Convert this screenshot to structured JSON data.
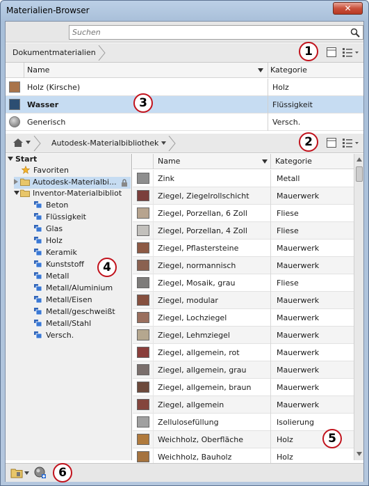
{
  "window": {
    "title": "Materialien-Browser",
    "close_label": "✕"
  },
  "search": {
    "placeholder": "Suchen"
  },
  "document": {
    "breadcrumb": "Dokumentmaterialien",
    "columns": {
      "name": "Name",
      "category": "Kategorie"
    },
    "rows": [
      {
        "name": "Holz (Kirsche)",
        "category": "Holz",
        "color": "#a9744a"
      },
      {
        "name": "Wasser",
        "category": "Flüssigkeit",
        "color": "#2c4e72",
        "selected": true
      },
      {
        "name": "Generisch",
        "category": "Versch.",
        "color": "#8a8a8a"
      }
    ]
  },
  "library": {
    "breadcrumb": "Autodesk-Materialbibliothek",
    "tree": {
      "root": "Start",
      "favorites": "Favoriten",
      "autodesk_lib": "Autodesk-Materialbi...",
      "inventor_lib": "Inventor-Materialbibliot",
      "categories": [
        "Beton",
        "Flüssigkeit",
        "Glas",
        "Holz",
        "Keramik",
        "Kunststoff",
        "Metall",
        "Metall/Aluminium",
        "Metall/Eisen",
        "Metall/geschweißt",
        "Metall/Stahl",
        "Versch."
      ]
    },
    "columns": {
      "name": "Name",
      "category": "Kategorie"
    },
    "rows": [
      {
        "name": "Zink",
        "category": "Metall",
        "color": "#8e8e8e"
      },
      {
        "name": "Ziegel, Ziegelrollschicht",
        "category": "Mauerwerk",
        "color": "#7b3f3c"
      },
      {
        "name": "Ziegel, Porzellan, 6 Zoll",
        "category": "Fliese",
        "color": "#b7a48f"
      },
      {
        "name": "Ziegel, Porzellan, 4 Zoll",
        "category": "Fliese",
        "color": "#c2c0bc"
      },
      {
        "name": "Ziegel, Pflastersteine",
        "category": "Mauerwerk",
        "color": "#8d5a45"
      },
      {
        "name": "Ziegel, normannisch",
        "category": "Mauerwerk",
        "color": "#8a6150"
      },
      {
        "name": "Ziegel, Mosaik, grau",
        "category": "Fliese",
        "color": "#7e7c7a"
      },
      {
        "name": "Ziegel, modular",
        "category": "Mauerwerk",
        "color": "#86503f"
      },
      {
        "name": "Ziegel, Lochziegel",
        "category": "Mauerwerk",
        "color": "#9a6f5e"
      },
      {
        "name": "Ziegel, Lehmziegel",
        "category": "Mauerwerk",
        "color": "#b5a78f"
      },
      {
        "name": "Ziegel, allgemein, rot",
        "category": "Mauerwerk",
        "color": "#8a3e3b"
      },
      {
        "name": "Ziegel, allgemein, grau",
        "category": "Mauerwerk",
        "color": "#7a6f6c"
      },
      {
        "name": "Ziegel, allgemein, braun",
        "category": "Mauerwerk",
        "color": "#6d4a3c"
      },
      {
        "name": "Ziegel, allgemein",
        "category": "Mauerwerk",
        "color": "#84453d"
      },
      {
        "name": "Zellulosefüllung",
        "category": "Isolierung",
        "color": "#a0a0a0"
      },
      {
        "name": "Weichholz, Oberfläche",
        "category": "Holz",
        "color": "#b07a3c"
      },
      {
        "name": "Weichholz, Bauholz",
        "category": "Holz",
        "color": "#a5733f"
      }
    ]
  },
  "badges": [
    "1",
    "2",
    "3",
    "4",
    "5",
    "6"
  ],
  "colors": {
    "selection": "#c6dcf2",
    "badge_ring": "#c1121c"
  }
}
